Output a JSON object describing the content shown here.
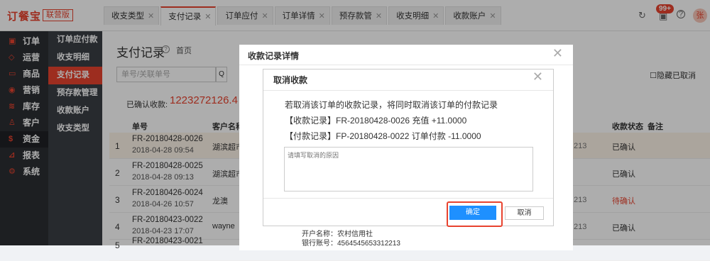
{
  "brand": {
    "logo": "订餐宝",
    "edition": "联营版"
  },
  "tabs": [
    {
      "label": "收支类型"
    },
    {
      "label": "支付记录"
    },
    {
      "label": "订单应付"
    },
    {
      "label": "订单详情"
    },
    {
      "label": "预存款管"
    },
    {
      "label": "收支明细"
    },
    {
      "label": "收款账户"
    }
  ],
  "tab_active_index": 1,
  "toolbar": {
    "badge": "99+",
    "avatar": "张"
  },
  "sidebar": [
    {
      "label": "订单",
      "icon": "order-icon"
    },
    {
      "label": "运营",
      "icon": "operation-icon"
    },
    {
      "label": "商品",
      "icon": "goods-icon"
    },
    {
      "label": "营销",
      "icon": "marketing-icon"
    },
    {
      "label": "库存",
      "icon": "inventory-icon"
    },
    {
      "label": "客户",
      "icon": "customer-icon"
    },
    {
      "label": "资金",
      "icon": "fund-icon"
    },
    {
      "label": "报表",
      "icon": "report-icon"
    },
    {
      "label": "系统",
      "icon": "system-icon"
    }
  ],
  "submenu": [
    {
      "label": "订单应付款"
    },
    {
      "label": "收支明细"
    },
    {
      "label": "支付记录"
    },
    {
      "label": "预存款管理"
    },
    {
      "label": "收款账户"
    },
    {
      "label": "收支类型"
    }
  ],
  "page": {
    "title": "支付记录",
    "home": "首页",
    "search_placeholder": "单号/关联单号",
    "hide_label": "隐藏已取消",
    "confirmed_label": "已确认收款:",
    "confirmed_amount": "1223272126.4"
  },
  "table": {
    "headers": {
      "no": "单号",
      "customer": "客户名称",
      "status": "收款状态",
      "remark": "备注"
    },
    "rows": [
      {
        "idx": "1",
        "no": "FR-20180428-0026",
        "date": "2018-04-28 09:54",
        "customer": "湖滨超市",
        "status": "已确认",
        "tail": "213"
      },
      {
        "idx": "2",
        "no": "FR-20180428-0025",
        "date": "2018-04-28 09:13",
        "customer": "湖滨超市",
        "status": "已确认",
        "tail": ""
      },
      {
        "idx": "3",
        "no": "FR-20180426-0024",
        "date": "2018-04-26 10:57",
        "customer": "龙澳",
        "status": "待确认",
        "tail": "213"
      },
      {
        "idx": "4",
        "no": "FR-20180423-0022",
        "date": "2018-04-23 17:07",
        "customer": "wayne",
        "status": "已确认",
        "tail": "213"
      },
      {
        "idx": "5",
        "no": "FR-20180423-0021",
        "date": "",
        "customer": "",
        "status": "",
        "tail": ""
      }
    ]
  },
  "detail_modal": {
    "title": "收款记录详情",
    "account_name": "开户名称：农村信用社",
    "account_no": "银行账号：4564545653312213"
  },
  "cancel_modal": {
    "title": "取消收款",
    "line1": "若取消该订单的收款记录，将同时取消该订单的付款记录",
    "line2": "【收款记录】FR-20180428-0026 充值 +11.0000",
    "line3": "【付款记录】FP-20180428-0022 订单付款 -11.0000",
    "reason_placeholder": "请填写取消的原因",
    "confirm": "确定",
    "cancel": "取消"
  },
  "colors": {
    "accent": "#e8432f",
    "primary": "#1e90ff"
  }
}
